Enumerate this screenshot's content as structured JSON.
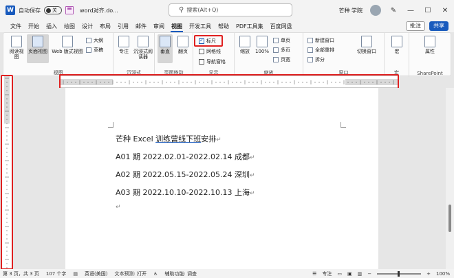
{
  "titlebar": {
    "autosave_label": "自动保存",
    "autosave_state": "关",
    "doc_title": "word对齐.do...",
    "search_placeholder": "搜索(Alt+Q)",
    "user_name": "芒种 学院",
    "accent_color": "#185abd"
  },
  "menu": {
    "tabs": [
      "文件",
      "开始",
      "插入",
      "绘图",
      "设计",
      "布局",
      "引用",
      "邮件",
      "审阅",
      "视图",
      "开发工具",
      "帮助",
      "PDF工具集",
      "百度网盘"
    ],
    "active_tab": "视图",
    "comment_label": "批注",
    "share_label": "共享"
  },
  "ribbon": {
    "views": {
      "read_mode": "阅读视图",
      "print_layout": "页面视图",
      "web_layout": "Web 版式视图",
      "outline": "大纲",
      "draft": "草稿",
      "label": "视图"
    },
    "immersive": {
      "focus": "专注",
      "immersive_reader": "沉浸式阅读器",
      "label": "沉浸式"
    },
    "page_movement": {
      "vertical": "垂直",
      "side_to_side": "翻页",
      "label": "页面移动"
    },
    "show": {
      "ruler": "标尺",
      "ruler_checked": true,
      "gridlines": "网格线",
      "gridlines_checked": false,
      "nav_pane": "导航窗格",
      "nav_pane_checked": false,
      "label": "显示"
    },
    "zoom": {
      "zoom": "缩放",
      "percent": "100%",
      "one_page": "单页",
      "multiple_pages": "多页",
      "page_width": "页宽",
      "label": "缩放"
    },
    "window": {
      "new_window": "新建窗口",
      "arrange_all": "全部重排",
      "split": "拆分",
      "switch_windows": "切换窗口",
      "label": "窗口"
    },
    "macros": {
      "macros": "宏",
      "label": "宏"
    },
    "sharepoint": {
      "properties": "属性",
      "label": "SharePoint"
    }
  },
  "document": {
    "lines": [
      "芒种 Excel 训练营线下班安排",
      "A01 期 2022.02.01-2022.02.14 成都",
      "A02 期 2022.05.15-2022.05.24 深圳",
      "A03 期 2022.10.10-2022.10.13 上海",
      ""
    ],
    "title_plain": "芒种 Excel ",
    "title_underlined": "训练营线下班",
    "title_rest": "安排",
    "para_mark": "↵"
  },
  "statusbar": {
    "page": "第 3 页，共 3 页",
    "words": "107 个字",
    "language": "英语(美国)",
    "text_prediction": "文本预测: 打开",
    "accessibility": "辅助功能: 调查",
    "focus": "专注",
    "zoom": "100%"
  },
  "highlight_color": "#e02020"
}
